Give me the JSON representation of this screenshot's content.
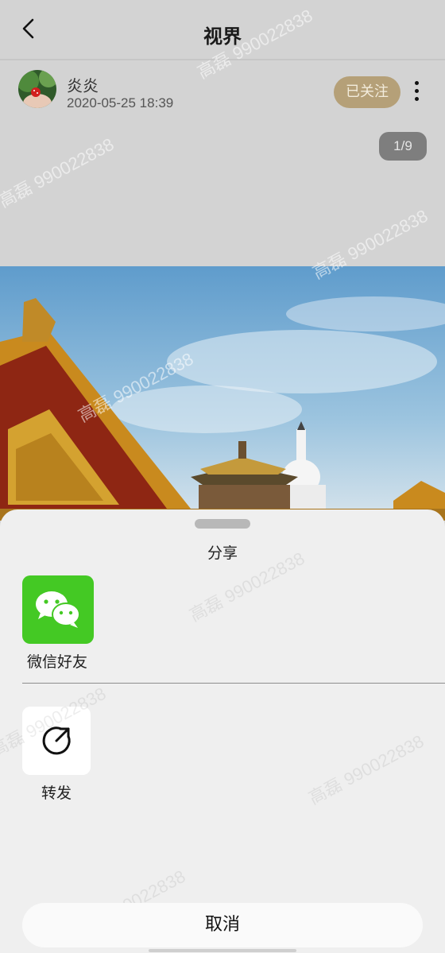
{
  "header": {
    "title": "视界"
  },
  "post": {
    "author_name": "炎炎",
    "timestamp": "2020-05-25 18:39",
    "follow_label": "已关注",
    "page_counter": "1/9"
  },
  "share_sheet": {
    "title": "分享",
    "options": [
      {
        "label": "微信好友",
        "icon": "wechat-icon"
      },
      {
        "label": "转发",
        "icon": "forward-icon"
      }
    ],
    "cancel_label": "取消"
  },
  "watermark_text": "高磊 990022838",
  "colors": {
    "follow_bg": "#b5a078",
    "wechat_green": "#44c924",
    "sky": "#76a9d1",
    "roof_gold": "#d29a2c",
    "roof_red": "#9a2a14"
  }
}
